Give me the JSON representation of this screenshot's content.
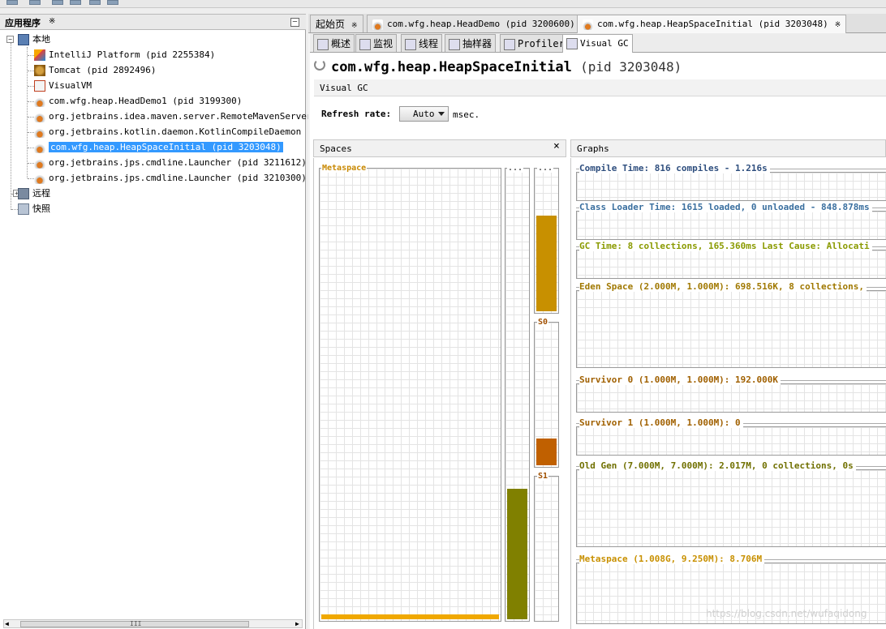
{
  "left_panel": {
    "title": "应用程序",
    "close_glyph": "※",
    "minimize_glyph": "–",
    "local_node": "本地",
    "remote_node": "远程",
    "snapshot_node": "快照",
    "apps": [
      {
        "label": "IntelliJ Platform  (pid 2255384)",
        "icon": "intellij-icon"
      },
      {
        "label": "Tomcat  (pid 2892496)",
        "icon": "tomcat-icon"
      },
      {
        "label": "VisualVM",
        "icon": "visualvm-icon"
      },
      {
        "label": "com.wfg.heap.HeadDemo1  (pid 3199300)",
        "icon": "java-icon"
      },
      {
        "label": "org.jetbrains.idea.maven.server.RemoteMavenServer  (p:",
        "icon": "java-icon"
      },
      {
        "label": "org.jetbrains.kotlin.daemon.KotlinCompileDaemon  (pid",
        "icon": "java-icon"
      },
      {
        "label": "com.wfg.heap.HeapSpaceInitial  (pid 3203048)",
        "icon": "java-icon",
        "selected": true
      },
      {
        "label": "org.jetbrains.jps.cmdline.Launcher  (pid 3211612)",
        "icon": "java-icon"
      },
      {
        "label": "org.jetbrains.jps.cmdline.Launcher  (pid 3210300)",
        "icon": "java-icon"
      }
    ],
    "scrollbar_glyph": "III"
  },
  "doc_tabs": [
    {
      "label": "起始页",
      "close": "※"
    },
    {
      "label": "com.wfg.heap.HeadDemo  (pid 3200600)",
      "close": "※"
    },
    {
      "label": "com.wfg.heap.HeapSpaceInitial  (pid 3203048)",
      "close": "※",
      "active": true
    }
  ],
  "sub_tabs": [
    {
      "label": "概述",
      "icon": "overview-icon"
    },
    {
      "label": "监视",
      "icon": "monitor-icon"
    },
    {
      "label": "线程",
      "icon": "threads-icon"
    },
    {
      "label": "抽样器",
      "icon": "sampler-icon"
    },
    {
      "label": "Profiler",
      "icon": "profiler-icon"
    },
    {
      "label": "Visual GC",
      "icon": "visualgc-icon",
      "active": true
    }
  ],
  "app_header": {
    "name": "com.wfg.heap.HeapSpaceInitial",
    "pid": "(pid 3203048)"
  },
  "visual_gc_label": "Visual GC",
  "refresh": {
    "label": "Refresh rate:",
    "value": "Auto",
    "unit": "msec."
  },
  "spaces": {
    "title": "Spaces",
    "close_glyph": "×",
    "metaspace_label": "Metaspace",
    "old_label": "...",
    "eden_label": "...",
    "s0_label": "S0",
    "s1_label": "S1",
    "fill_fractions": {
      "metaspace": 0.01,
      "old": 0.29,
      "eden": 0.67,
      "s0": 0.19,
      "s1": 0.0
    }
  },
  "graphs": {
    "title": "Graphs",
    "items": [
      {
        "title": "Compile Time: 816 compiles - 1.216s",
        "color": "#2e4e7e"
      },
      {
        "title": "Class Loader Time: 1615 loaded, 0 unloaded - 848.878ms",
        "color": "#3a6f9f"
      },
      {
        "title": "GC Time: 8 collections, 165.360ms Last Cause: Allocati",
        "color": "#8a9a00"
      },
      {
        "title": "Eden Space (2.000M, 1.000M): 698.516K, 8 collections,",
        "color": "#a07800"
      },
      {
        "title": "Survivor 0 (1.000M, 1.000M): 192.000K",
        "color": "#a06000"
      },
      {
        "title": "Survivor 1 (1.000M, 1.000M): 0",
        "color": "#a06000"
      },
      {
        "title": "Old Gen (7.000M, 7.000M): 2.017M, 0 collections, 0s",
        "color": "#707000"
      },
      {
        "title": "Metaspace (1.008G, 9.250M): 8.706M",
        "color": "#c89000"
      }
    ]
  },
  "colors": {
    "metaspace_fill": "#f0a800",
    "old_fill": "#808000",
    "eden_fill": "#c89000",
    "s0_fill": "#c06000",
    "selection": "#3399ff"
  },
  "watermark": "https://blog.csdn.net/wufaqidong"
}
